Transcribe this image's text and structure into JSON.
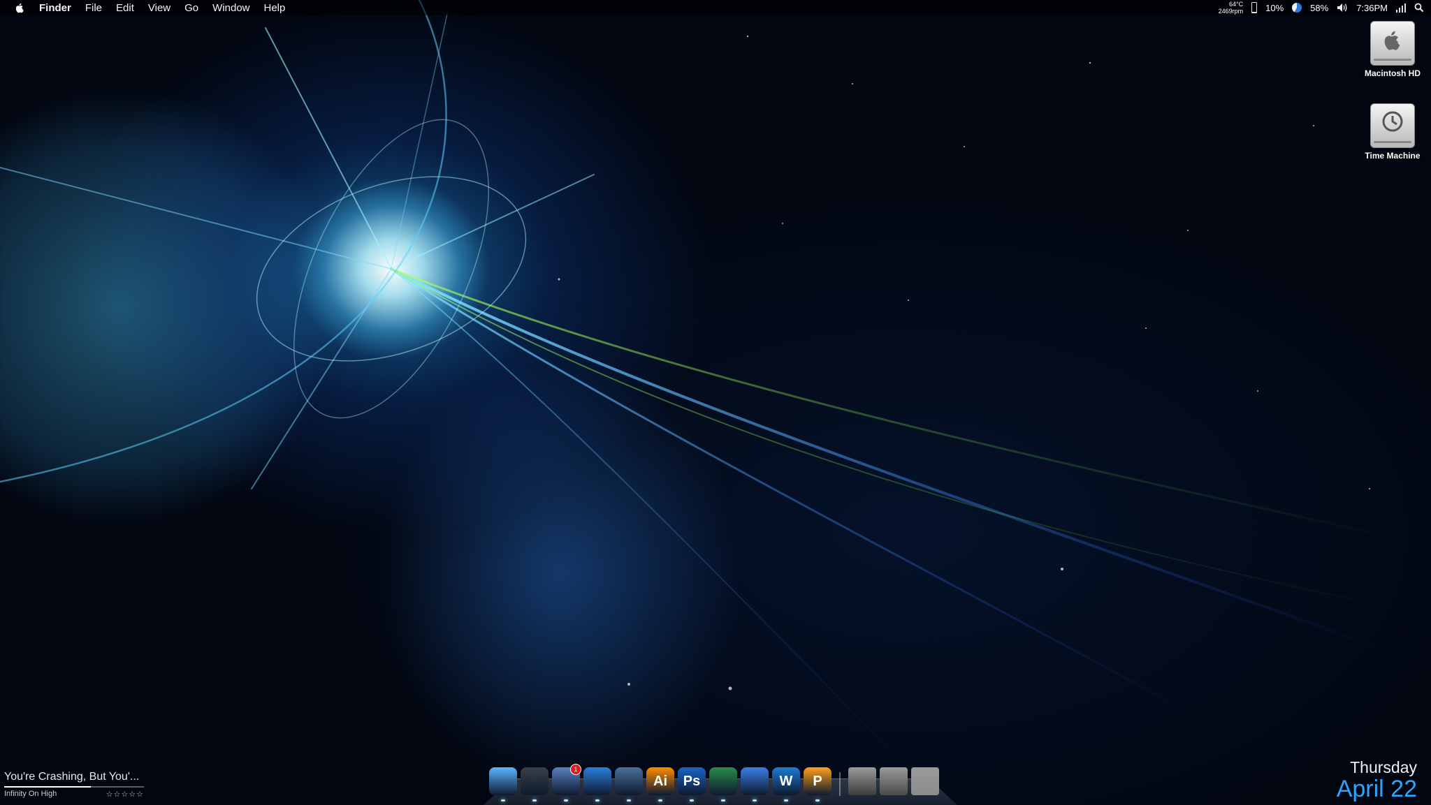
{
  "menubar": {
    "apple_icon": "apple-icon",
    "items": [
      "Finder",
      "File",
      "Edit",
      "View",
      "Go",
      "Window",
      "Help"
    ]
  },
  "status": {
    "temperature": "64°C",
    "fan_speed": "2469rpm",
    "battery": "10%",
    "battery_level": 0.1,
    "cpu_pie": "58%",
    "cpu_level": 0.58,
    "time": "7:36PM"
  },
  "desktop_icons": [
    {
      "label": "Macintosh HD",
      "icon": "hard-drive-icon"
    },
    {
      "label": "Time Machine",
      "icon": "time-machine-drive-icon"
    }
  ],
  "dock": {
    "items": [
      {
        "name": "finder",
        "text": "",
        "color": "#5cb6ff",
        "badge": ""
      },
      {
        "name": "time-machine",
        "text": "",
        "color": "#3a3f47",
        "badge": ""
      },
      {
        "name": "mail",
        "text": "",
        "color": "#5a7fbf",
        "badge": "1"
      },
      {
        "name": "safari",
        "text": "",
        "color": "#2b7fd9",
        "badge": ""
      },
      {
        "name": "iphoto",
        "text": "",
        "color": "#4a6f9a",
        "badge": ""
      },
      {
        "name": "illustrator",
        "text": "Ai",
        "color": "#ff8c00",
        "badge": ""
      },
      {
        "name": "photoshop",
        "text": "Ps",
        "color": "#1a64c8",
        "badge": ""
      },
      {
        "name": "messenger",
        "text": "",
        "color": "#2a8a4a",
        "badge": ""
      },
      {
        "name": "itunes",
        "text": "",
        "color": "#3b7fe6",
        "badge": ""
      },
      {
        "name": "word",
        "text": "W",
        "color": "#1e7ad3",
        "badge": ""
      },
      {
        "name": "powerpoint",
        "text": "P",
        "color": "#ff9f1a",
        "badge": ""
      }
    ],
    "right_items": [
      {
        "name": "downloads",
        "color": "#3c3c3c"
      },
      {
        "name": "documents",
        "color": "#4a4a4a"
      },
      {
        "name": "trash",
        "color": "#8c8c8c"
      }
    ]
  },
  "now_playing": {
    "title": "You're Crashing, But You'...",
    "album": "Infinity On High",
    "rating": "☆☆☆☆☆",
    "progress": 0.62
  },
  "date_widget": {
    "day": "Thursday",
    "date": "April 22"
  }
}
